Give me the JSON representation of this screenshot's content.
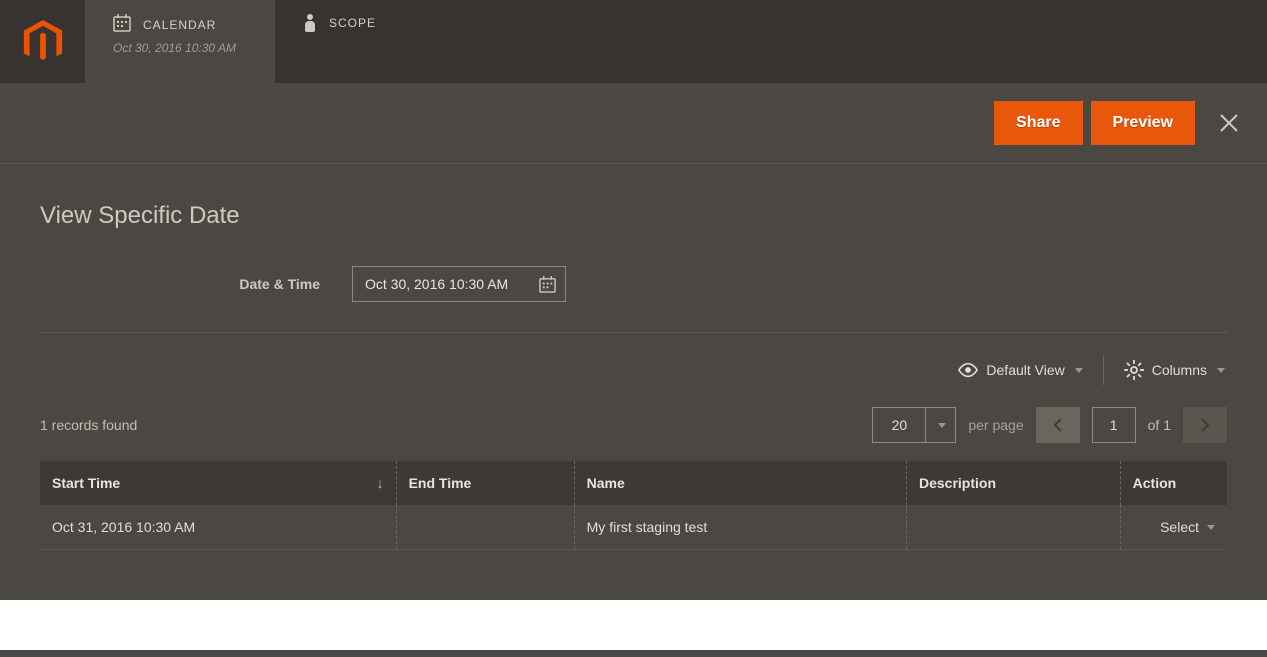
{
  "tabs": {
    "calendar": {
      "label": "CALENDAR",
      "sub": "Oct 30, 2016 10:30 AM"
    },
    "scope": {
      "label": "SCOPE"
    }
  },
  "actions": {
    "share": "Share",
    "preview": "Preview"
  },
  "page": {
    "title": "View Specific Date",
    "field_label": "Date & Time",
    "date_value": "Oct 30, 2016 10:30 AM"
  },
  "toolbar": {
    "default_view": "Default View",
    "columns": "Columns"
  },
  "pager": {
    "records_found": "1 records found",
    "per_page_value": "20",
    "per_page_label": "per page",
    "page_current": "1",
    "of_label": "of 1"
  },
  "table": {
    "headers": {
      "start_time": "Start Time",
      "end_time": "End Time",
      "name": "Name",
      "description": "Description",
      "action": "Action"
    },
    "rows": [
      {
        "start_time": "Oct 31, 2016 10:30 AM",
        "end_time": "",
        "name": "My first staging test",
        "description": "",
        "action": "Select"
      }
    ]
  }
}
